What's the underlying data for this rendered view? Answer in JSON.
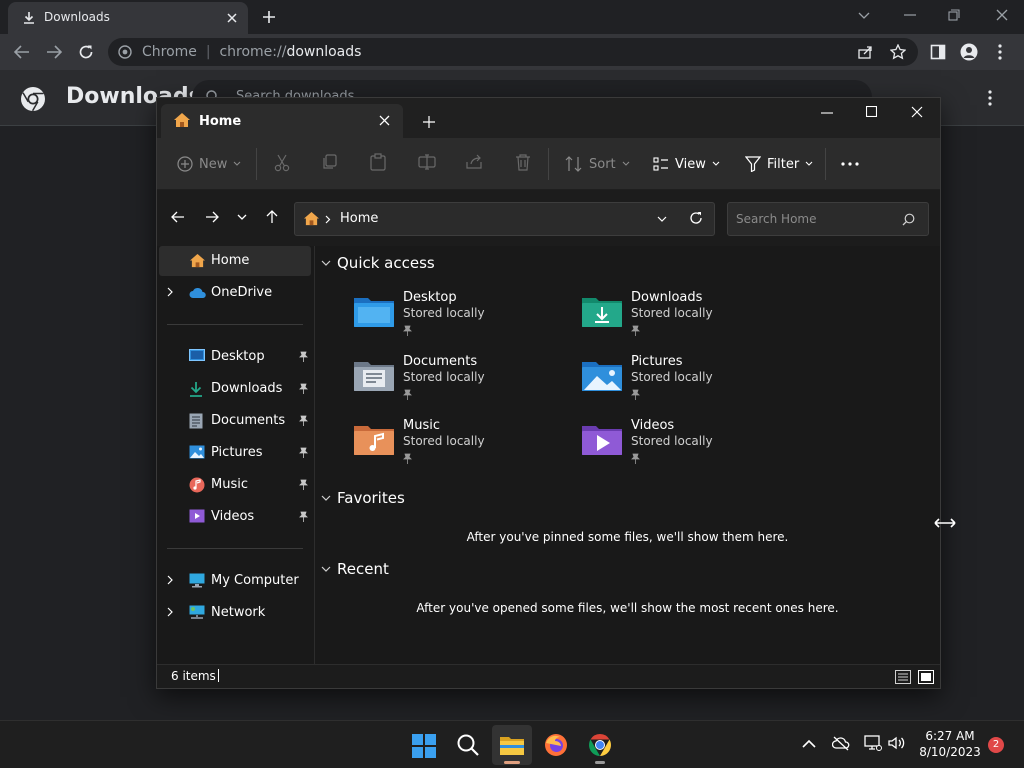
{
  "chrome": {
    "tab_title": "Downloads",
    "url_host": "Chrome",
    "url_prefix": "chrome://",
    "url_path": "downloads",
    "page_title": "Downloads",
    "search_placeholder": "Search downloads"
  },
  "explorer": {
    "tab_title": "Home",
    "toolbar": {
      "new_label": "New",
      "sort_label": "Sort",
      "view_label": "View",
      "filter_label": "Filter"
    },
    "address": {
      "crumb": "Home"
    },
    "search_placeholder": "Search Home",
    "nav": {
      "home": "Home",
      "onedrive": "OneDrive",
      "pinned": [
        {
          "label": "Desktop",
          "icon": "desktop-icon"
        },
        {
          "label": "Downloads",
          "icon": "downloads-icon"
        },
        {
          "label": "Documents",
          "icon": "documents-icon"
        },
        {
          "label": "Pictures",
          "icon": "pictures-icon"
        },
        {
          "label": "Music",
          "icon": "music-icon"
        },
        {
          "label": "Videos",
          "icon": "videos-icon"
        }
      ],
      "my_computer": "My Computer",
      "network": "Network"
    },
    "sections": {
      "quick_access": "Quick access",
      "favorites": "Favorites",
      "recent": "Recent"
    },
    "quick_access_items": [
      {
        "name": "Desktop",
        "status": "Stored locally",
        "icon": "desktop-folder-icon"
      },
      {
        "name": "Downloads",
        "status": "Stored locally",
        "icon": "downloads-folder-icon"
      },
      {
        "name": "Documents",
        "status": "Stored locally",
        "icon": "documents-folder-icon"
      },
      {
        "name": "Pictures",
        "status": "Stored locally",
        "icon": "pictures-folder-icon"
      },
      {
        "name": "Music",
        "status": "Stored locally",
        "icon": "music-folder-icon"
      },
      {
        "name": "Videos",
        "status": "Stored locally",
        "icon": "videos-folder-icon"
      }
    ],
    "favorites_empty": "After you've pinned some files, we'll show them here.",
    "recent_empty": "After you've opened some files, we'll show the most recent ones here.",
    "status_count": "6 items"
  },
  "taskbar": {
    "time": "6:27 AM",
    "date": "8/10/2023",
    "notification_count": "2"
  },
  "colors": {
    "folder_blue": "#2f8fdc",
    "folder_teal": "#23a88a",
    "folder_gray": "#9aa6b4",
    "folder_orange": "#e8915a",
    "folder_purple": "#8f5ad6",
    "home_orange": "#f0a64b"
  }
}
